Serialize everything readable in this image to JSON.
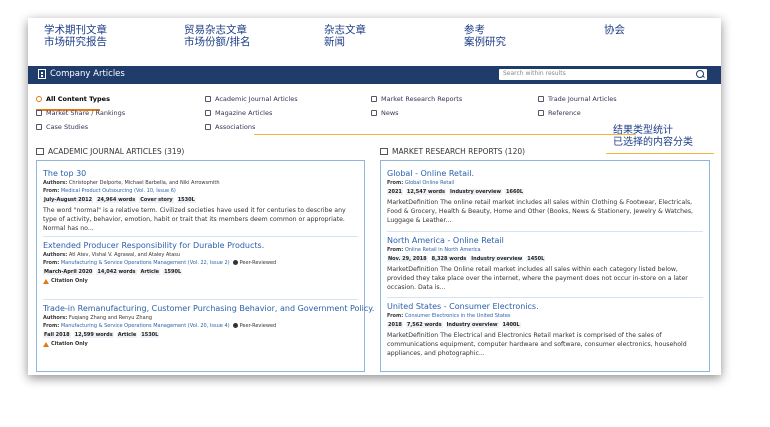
{
  "legend": {
    "col1": [
      "学术期刊文章",
      "市场研究报告"
    ],
    "col2": [
      "贸易杂志文章",
      "市场份额/排名"
    ],
    "col3": [
      "杂志文章",
      "新闻"
    ],
    "col4": [
      "参考",
      "案例研究"
    ],
    "col5": [
      "协会"
    ]
  },
  "header": {
    "title": "Company Articles",
    "search_placeholder": "Search within results"
  },
  "filters": [
    {
      "label": "All Content Types",
      "active": true
    },
    {
      "label": "Academic Journal Articles"
    },
    {
      "label": "Market Research Reports"
    },
    {
      "label": "Trade Journal Articles"
    },
    {
      "label": "Market Share / Rankings"
    },
    {
      "label": "Magazine Articles"
    },
    {
      "label": "News"
    },
    {
      "label": "Reference"
    },
    {
      "label": "Case Studies"
    },
    {
      "label": "Associations"
    }
  ],
  "callout": [
    "结果类型统计",
    "已选择的内容分类"
  ],
  "left_section": {
    "heading": "ACADEMIC JOURNAL ARTICLES (319)",
    "cards": [
      {
        "title": "The top 30",
        "authors_label": "Authors:",
        "authors": "Christopher Delporte, Michael Barbella, and Niki Arrowsmith",
        "from_label": "From:",
        "from": "Medical Product Outsourcing (Vol. 10, Issue 6)",
        "badges": [
          "July-August 2012",
          "24,964 words",
          "Cover story",
          "1530L"
        ],
        "desc": "The word \"normal\" is a relative term. Civilized societies have used it for centuries to describe any type of activity, behavior, emotion, habit or trait that its members deem common or appropriate. Normal has no..."
      },
      {
        "title": "Extended Producer Responsibility for Durable Products.",
        "authors_label": "Authors:",
        "authors": "Atl Atev, Vishal V. Agrawal, and Ataley Atasu",
        "from_label": "From:",
        "from": "Manufacturing & Service Operations Management (Vol. 22, Issue 2)",
        "peer": "Peer-Reviewed",
        "badges": [
          "March-April 2020",
          "14,042 words",
          "Article",
          "1590L"
        ],
        "citation": "Citation Only"
      },
      {
        "title": "Trade-in Remanufacturing, Customer Purchasing Behavior, and Government Policy.",
        "authors_label": "Authors:",
        "authors": "Fuqiang Zhang and Renyu Zhang",
        "from_label": "From:",
        "from": "Manufacturing & Service Operations Management (Vol. 20, Issue 4)",
        "peer": "Peer-Reviewed",
        "badges": [
          "Fall 2018",
          "12,599 words",
          "Article",
          "1530L"
        ],
        "citation": "Citation Only"
      }
    ]
  },
  "right_section": {
    "heading": "MARKET RESEARCH REPORTS (120)",
    "cards": [
      {
        "title": "Global - Online Retail.",
        "from_label": "From:",
        "from": "Global Online Retail",
        "badges": [
          "2021",
          "12,547 words",
          "Industry overview",
          "1660L"
        ],
        "desc": "MarketDefinition The online retail market includes all sales within Clothing & Footwear, Electricals, Food & Grocery, Health & Beauty, Home and Other (Books, News & Stationery, Jewelry & Watches, Luggage & Leather..."
      },
      {
        "title": "North America - Online Retail",
        "from_label": "From:",
        "from": "Online Retail in North America",
        "badges": [
          "Nov. 29, 2018",
          "8,328 words",
          "Industry overview",
          "1450L"
        ],
        "desc": "MarketDefinition The Online retail market includes all sales within each category listed below, provided they take place over the internet, where the payment does not occur in-store on a later occasion. Data is..."
      },
      {
        "title": "United States - Consumer Electronics.",
        "from_label": "From:",
        "from": "Consumer Electronics in the United States",
        "badges": [
          "2018",
          "7,562 words",
          "Industry overview",
          "1400L"
        ],
        "desc": "MarketDefinition The Electrical and Electronics Retail market is comprised of the sales of communications equipment, computer hardware and software, consumer electronics, household appliances, and photographic..."
      }
    ]
  }
}
